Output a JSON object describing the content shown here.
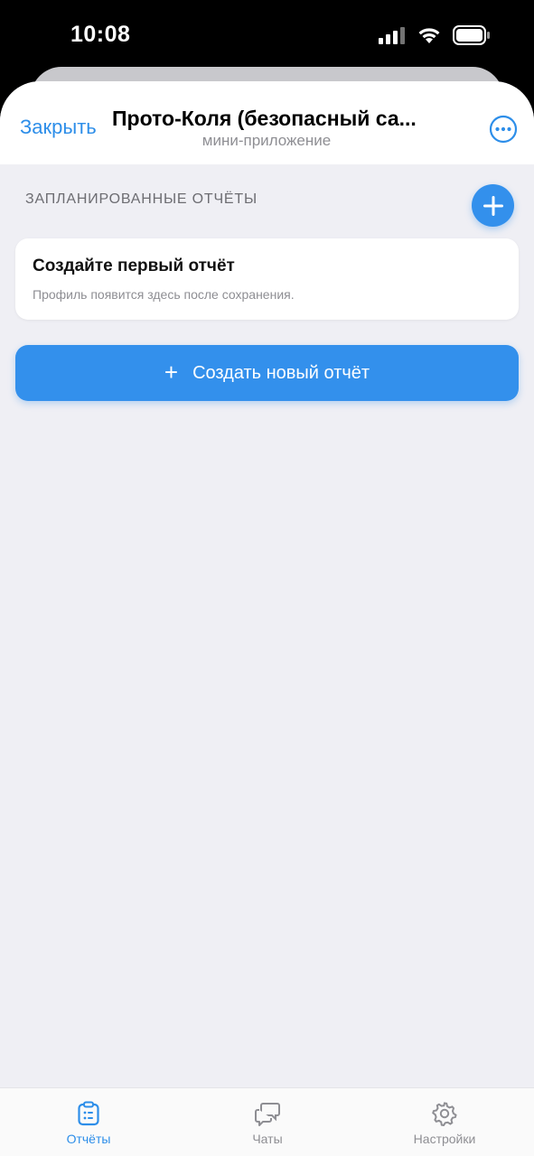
{
  "status_bar": {
    "time": "10:08"
  },
  "header": {
    "close_label": "Закрыть",
    "title": "Прото-Коля (безопасный са...",
    "subtitle": "мини-приложение",
    "more_icon": "more-circle-icon"
  },
  "main": {
    "section_label": "ЗАПЛАНИРОВАННЫЕ ОТЧЁТЫ",
    "add_icon": "plus-icon",
    "empty_state": {
      "title": "Создайте первый отчёт",
      "subtitle": "Профиль появится здесь после сохранения."
    },
    "create_button": {
      "icon": "+",
      "label": "Создать новый отчёт"
    }
  },
  "tabbar": {
    "tabs": [
      {
        "label": "Отчёты",
        "icon": "clipboard-icon",
        "active": true
      },
      {
        "label": "Чаты",
        "icon": "chat-bubbles-icon",
        "active": false
      },
      {
        "label": "Настройки",
        "icon": "gear-icon",
        "active": false
      }
    ]
  },
  "colors": {
    "accent": "#3390ec",
    "link": "#2d8ee9",
    "background": "#efeff4",
    "inactive": "#8e8e93"
  }
}
